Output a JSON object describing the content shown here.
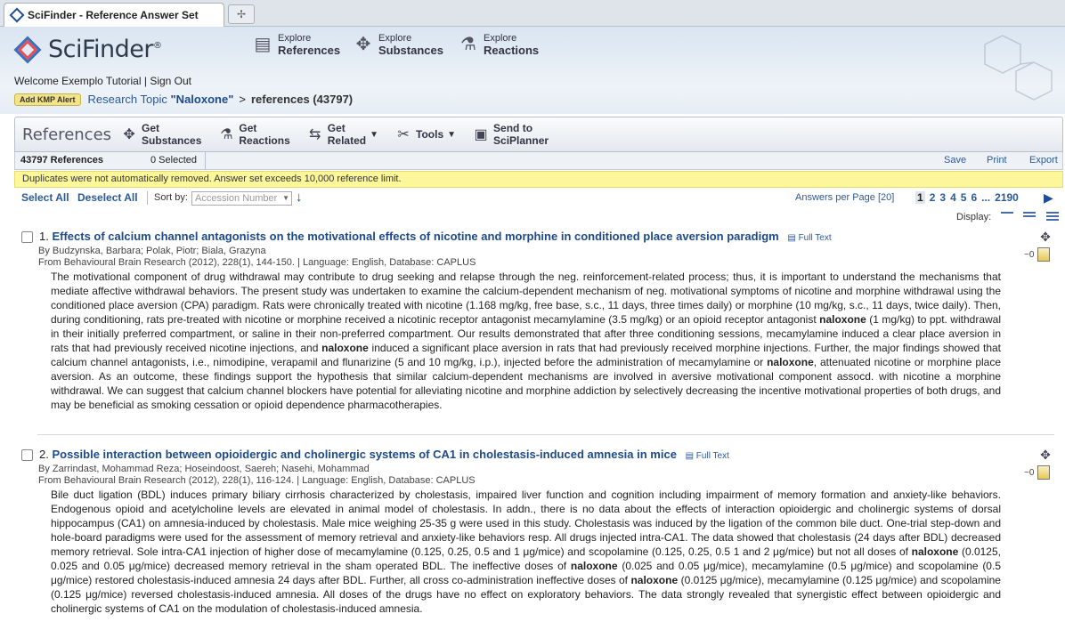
{
  "browser": {
    "tab_title": "SciFinder - Reference Answer Set",
    "new_tab_glyph": "✢"
  },
  "header": {
    "logo_text": "SciFinder",
    "logo_mark": "®",
    "explore": [
      {
        "line1": "Explore",
        "line2": "References",
        "icon": "references-icon"
      },
      {
        "line1": "Explore",
        "line2": "Substances",
        "icon": "substances-icon"
      },
      {
        "line1": "Explore",
        "line2": "Reactions",
        "icon": "reactions-icon"
      }
    ],
    "welcome": "Welcome Exemplo Tutorial",
    "separator": "|",
    "sign_out": "Sign Out",
    "kmp_alert": "Add KMP Alert",
    "topic_prefix": "Research Topic",
    "topic_query": "\"Naloxone\"",
    "crumb_sep": ">",
    "current": "references (43797)"
  },
  "toolbar": {
    "title": "References",
    "buttons": [
      {
        "line1": "Get",
        "line2": "Substances",
        "icon": "molecule-icon"
      },
      {
        "line1": "Get",
        "line2": "Reactions",
        "icon": "flask-icon"
      },
      {
        "line1": "Get",
        "line2": "Related",
        "icon": "related-icon",
        "dropdown": true
      },
      {
        "line1": "Tools",
        "line2": "",
        "icon": "tools-icon",
        "dropdown": true
      },
      {
        "line1": "Send to",
        "line2": "SciPlanner",
        "icon": "sciplanner-icon"
      }
    ]
  },
  "countbar": {
    "count": "43797 References",
    "selected": "0 Selected",
    "save": "Save",
    "print": "Print",
    "export": "Export"
  },
  "notice": "Duplicates were not automatically removed. Answer set exceeds 10,000 reference limit.",
  "controls": {
    "select_all": "Select All",
    "deselect_all": "Deselect All",
    "sort_label": "Sort by:",
    "sort_value": "Accession Number",
    "answers_per_page_label": "Answers per Page",
    "answers_per_page_value": "[20]",
    "pages": [
      "1",
      "2",
      "3",
      "4",
      "5",
      "6",
      "...",
      "2190"
    ],
    "current_page": "1"
  },
  "display_label": "Display:",
  "results": [
    {
      "number": "1.",
      "title": "Effects of calcium channel antagonists on the motivational effects of nicotine and morphine in conditioned place aversion paradigm",
      "full_text": "Full Text",
      "authors": "By Budzynska, Barbara; Polak, Piotr; Biala, Grazyna",
      "source": "From Behavioural Brain Research (2012), 228(1), 144-150.  | Language: English, Database: CAPLUS",
      "citations": "~0",
      "abstract_parts": [
        "The motivational component of drug withdrawal may contribute to drug seeking and relapse through the neg. reinforcement-related process; thus, it is important to understand the mechanisms that mediate affective withdrawal behaviors.  The present study was undertaken to examine the calcium-dependent mechanism of neg. motivational symptoms of nicotine and morphine withdrawal using the conditioned place aversion (CPA) paradigm.  Rats were chronically treated with nicotine (1.168 mg/kg, free base, s.c., 11 days, three times daily) or morphine (10 mg/kg, s.c., 11 days, twice daily).  Then, during conditioning, rats pre-treated with nicotine or morphine received a nicotinic receptor antagonist mecamylamine (3.5 mg/kg) or an opioid receptor antagonist ",
        "naloxone",
        " (1 mg/kg) to ppt. withdrawal in their initially preferred compartment, or saline in their non-preferred compartment.  Our results demonstrated that after three conditioning sessions, mecamylamine induced a clear place aversion in rats that had previously received nicotine injections, and ",
        "naloxone",
        " induced a significant place aversion in rats that had previously received morphine injections.  Further, the major findings showed that calcium channel antagonists, i.e., nimodipine, verapamil and flunarizine (5 and 10 mg/kg, i.p.), injected before the administration of mecamylamine or ",
        "naloxone",
        ", attenuated nicotine or morphine place aversion.  As an outcome, these findings support the hypothesis that similar calcium-dependent mechanisms are involved in aversive motivational component assocd. with nicotine a morphine withdrawal.  We can suggest that calcium channel blockers have potential for alleviating nicotine and morphine addiction by selectively decreasing the incentive motivational properties of both drugs, and may be beneficial as smoking cessation or opioid dependence pharmacotherapies."
      ]
    },
    {
      "number": "2.",
      "title": "Possible interaction between opioidergic and cholinergic systems of CA1 in cholestasis-induced amnesia in mice",
      "full_text": "Full Text",
      "authors": "By Zarrindast, Mohammad Reza; Hoseindoost, Saereh; Nasehi, Mohammad",
      "source": "From Behavioural Brain Research (2012), 228(1), 116-124.  | Language: English, Database: CAPLUS",
      "citations": "~0",
      "abstract_parts": [
        "Bile duct ligation (BDL) induces primary biliary cirrhosis characterized by cholestasis, impaired liver function and cognition including impairment of memory formation and anxiety-like behaviors.  Endogenous opioid and acetylcholine levels are elevated in animal model of cholestasis.  In addn., there is no data about the effects of interaction opioidergic and cholinergic systems of dorsal hippocampus (CA1) on amnesia-induced by cholestasis.  Male mice weighing 25-35 g were used in this study.  Cholestasis was induced by the ligation of the common bile duct.  One-trial step-down and hole-board paradigms were used for the assessment of memory retrieval and anxiety-like behaviors resp.  All drugs injected intra-CA1.  The data showed that cholestasis (24 days after BDL) decreased memory retrieval.  Sole intra-CA1 injection of higher dose of mecamylamine (0.125, 0.25, 0.5 and 1 μg/mice) and scopolamine (0.125, 0.25, 0.5 1 and 2 μg/mice) but not all doses of ",
        "naloxone",
        " (0.0125, 0.025 and 0.05 μg/mice) decreased memory retrieval in the sham operated BDL.  The ineffective doses of ",
        "naloxone",
        " (0.025 and 0.05 μg/mice), mecamylamine (0.5 μg/mice) and scopolamine (0.5 μg/mice) restored cholestasis-induced amnesia 24 days after BDL.  Further, all cross co-administration ineffective doses of ",
        "naloxone",
        " (0.0125 μg/mice), mecamylamine (0.125 μg/mice) and scopolamine (0.125 μg/mice) reversed cholestasis-induced amnesia.  All doses of the drugs have no effect on exploratory behaviors.  The data strongly revealed that synergistic effect between opioidergic and cholinergic systems of CA1 on the modulation of cholestasis-induced amnesia."
      ]
    }
  ]
}
